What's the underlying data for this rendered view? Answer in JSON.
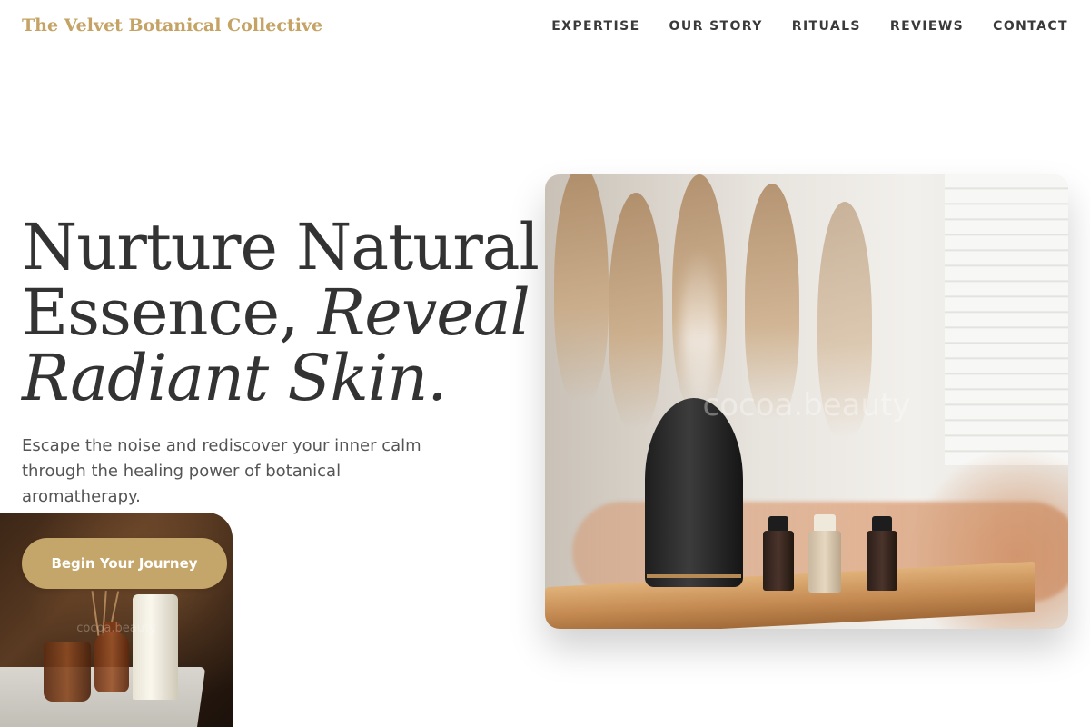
{
  "header": {
    "brand": "The Velvet Botanical Collective",
    "nav": [
      "EXPERTISE",
      "OUR STORY",
      "RITUALS",
      "REVIEWS",
      "CONTACT"
    ]
  },
  "hero": {
    "headline_line1": "Nurture Natural",
    "headline_line2_plain": "Essence, ",
    "headline_line2_italic": "Reveal",
    "headline_line3_italic": "Radiant Skin.",
    "subtext": "Escape the noise and rediscover your inner calm through the healing power of botanical aromatherapy.",
    "cta_label": "Begin Your Journey",
    "image_watermark": "cocoa.beauty",
    "small_card_watermark": "cocoa.beauty"
  },
  "colors": {
    "accent": "#c4a56a",
    "brand": "#c4a365",
    "heading": "#333333",
    "body": "#555555"
  }
}
